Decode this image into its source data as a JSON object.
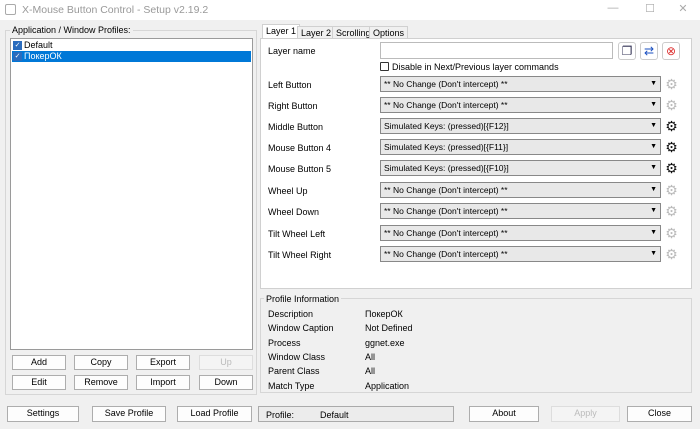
{
  "window": {
    "title": "X-Mouse Button Control - Setup v2.19.2",
    "min": "—",
    "max": "☐",
    "close": "✕"
  },
  "profiles": {
    "label": "Application / Window Profiles:",
    "items": [
      {
        "label": "Default",
        "checked": true,
        "selected": false
      },
      {
        "label": "ПокерОК",
        "checked": true,
        "selected": true
      }
    ]
  },
  "profile_buttons": [
    {
      "label": "Add",
      "enabled": true
    },
    {
      "label": "Copy",
      "enabled": true
    },
    {
      "label": "Export",
      "enabled": true
    },
    {
      "label": "Up",
      "enabled": false
    },
    {
      "label": "Edit",
      "enabled": true
    },
    {
      "label": "Remove",
      "enabled": true
    },
    {
      "label": "Import",
      "enabled": true
    },
    {
      "label": "Down",
      "enabled": true
    }
  ],
  "tabs": [
    {
      "label": "Layer 1",
      "active": true
    },
    {
      "label": "Layer 2"
    },
    {
      "label": "Scrolling"
    },
    {
      "label": "Options"
    }
  ],
  "layer": {
    "name_label": "Layer name",
    "name_value": "",
    "disable_label": "Disable in Next/Previous layer commands",
    "disable_checked": false,
    "rows": [
      {
        "label": "Left Button",
        "value": "** No Change (Don't intercept) **",
        "gear_active": false
      },
      {
        "label": "Right Button",
        "value": "** No Change (Don't intercept) **",
        "gear_active": false
      },
      {
        "label": "Middle Button",
        "value": "Simulated Keys: (pressed)[{F12}]",
        "gear_active": true
      },
      {
        "label": "Mouse Button 4",
        "value": "Simulated Keys: (pressed)[{F11}]",
        "gear_active": true
      },
      {
        "label": "Mouse Button 5",
        "value": "Simulated Keys: (pressed)[{F10}]",
        "gear_active": true
      },
      {
        "label": "Wheel Up",
        "value": "** No Change (Don't intercept) **",
        "gear_active": false
      },
      {
        "label": "Wheel Down",
        "value": "** No Change (Don't intercept) **",
        "gear_active": false
      },
      {
        "label": "Tilt Wheel Left",
        "value": "** No Change (Don't intercept) **",
        "gear_active": false
      },
      {
        "label": "Tilt Wheel Right",
        "value": "** No Change (Don't intercept) **",
        "gear_active": false
      }
    ]
  },
  "profile_info": {
    "label": "Profile Information",
    "rows": [
      {
        "label": "Description",
        "value": "ПокерОК"
      },
      {
        "label": "Window Caption",
        "value": "Not Defined"
      },
      {
        "label": "Process",
        "value": "ggnet.exe"
      },
      {
        "label": "Window Class",
        "value": "All"
      },
      {
        "label": "Parent Class",
        "value": "All"
      },
      {
        "label": "Match Type",
        "value": "Application"
      }
    ]
  },
  "bottom": {
    "settings": "Settings",
    "save": "Save Profile",
    "load": "Load Profile",
    "profile_label": "Profile:",
    "profile_value": "Default",
    "about": "About",
    "apply": "Apply",
    "close": "Close"
  },
  "colors": {
    "selection": "#0078d7",
    "checkbox": "#2a6bbd",
    "delete_icon": "#d33"
  }
}
